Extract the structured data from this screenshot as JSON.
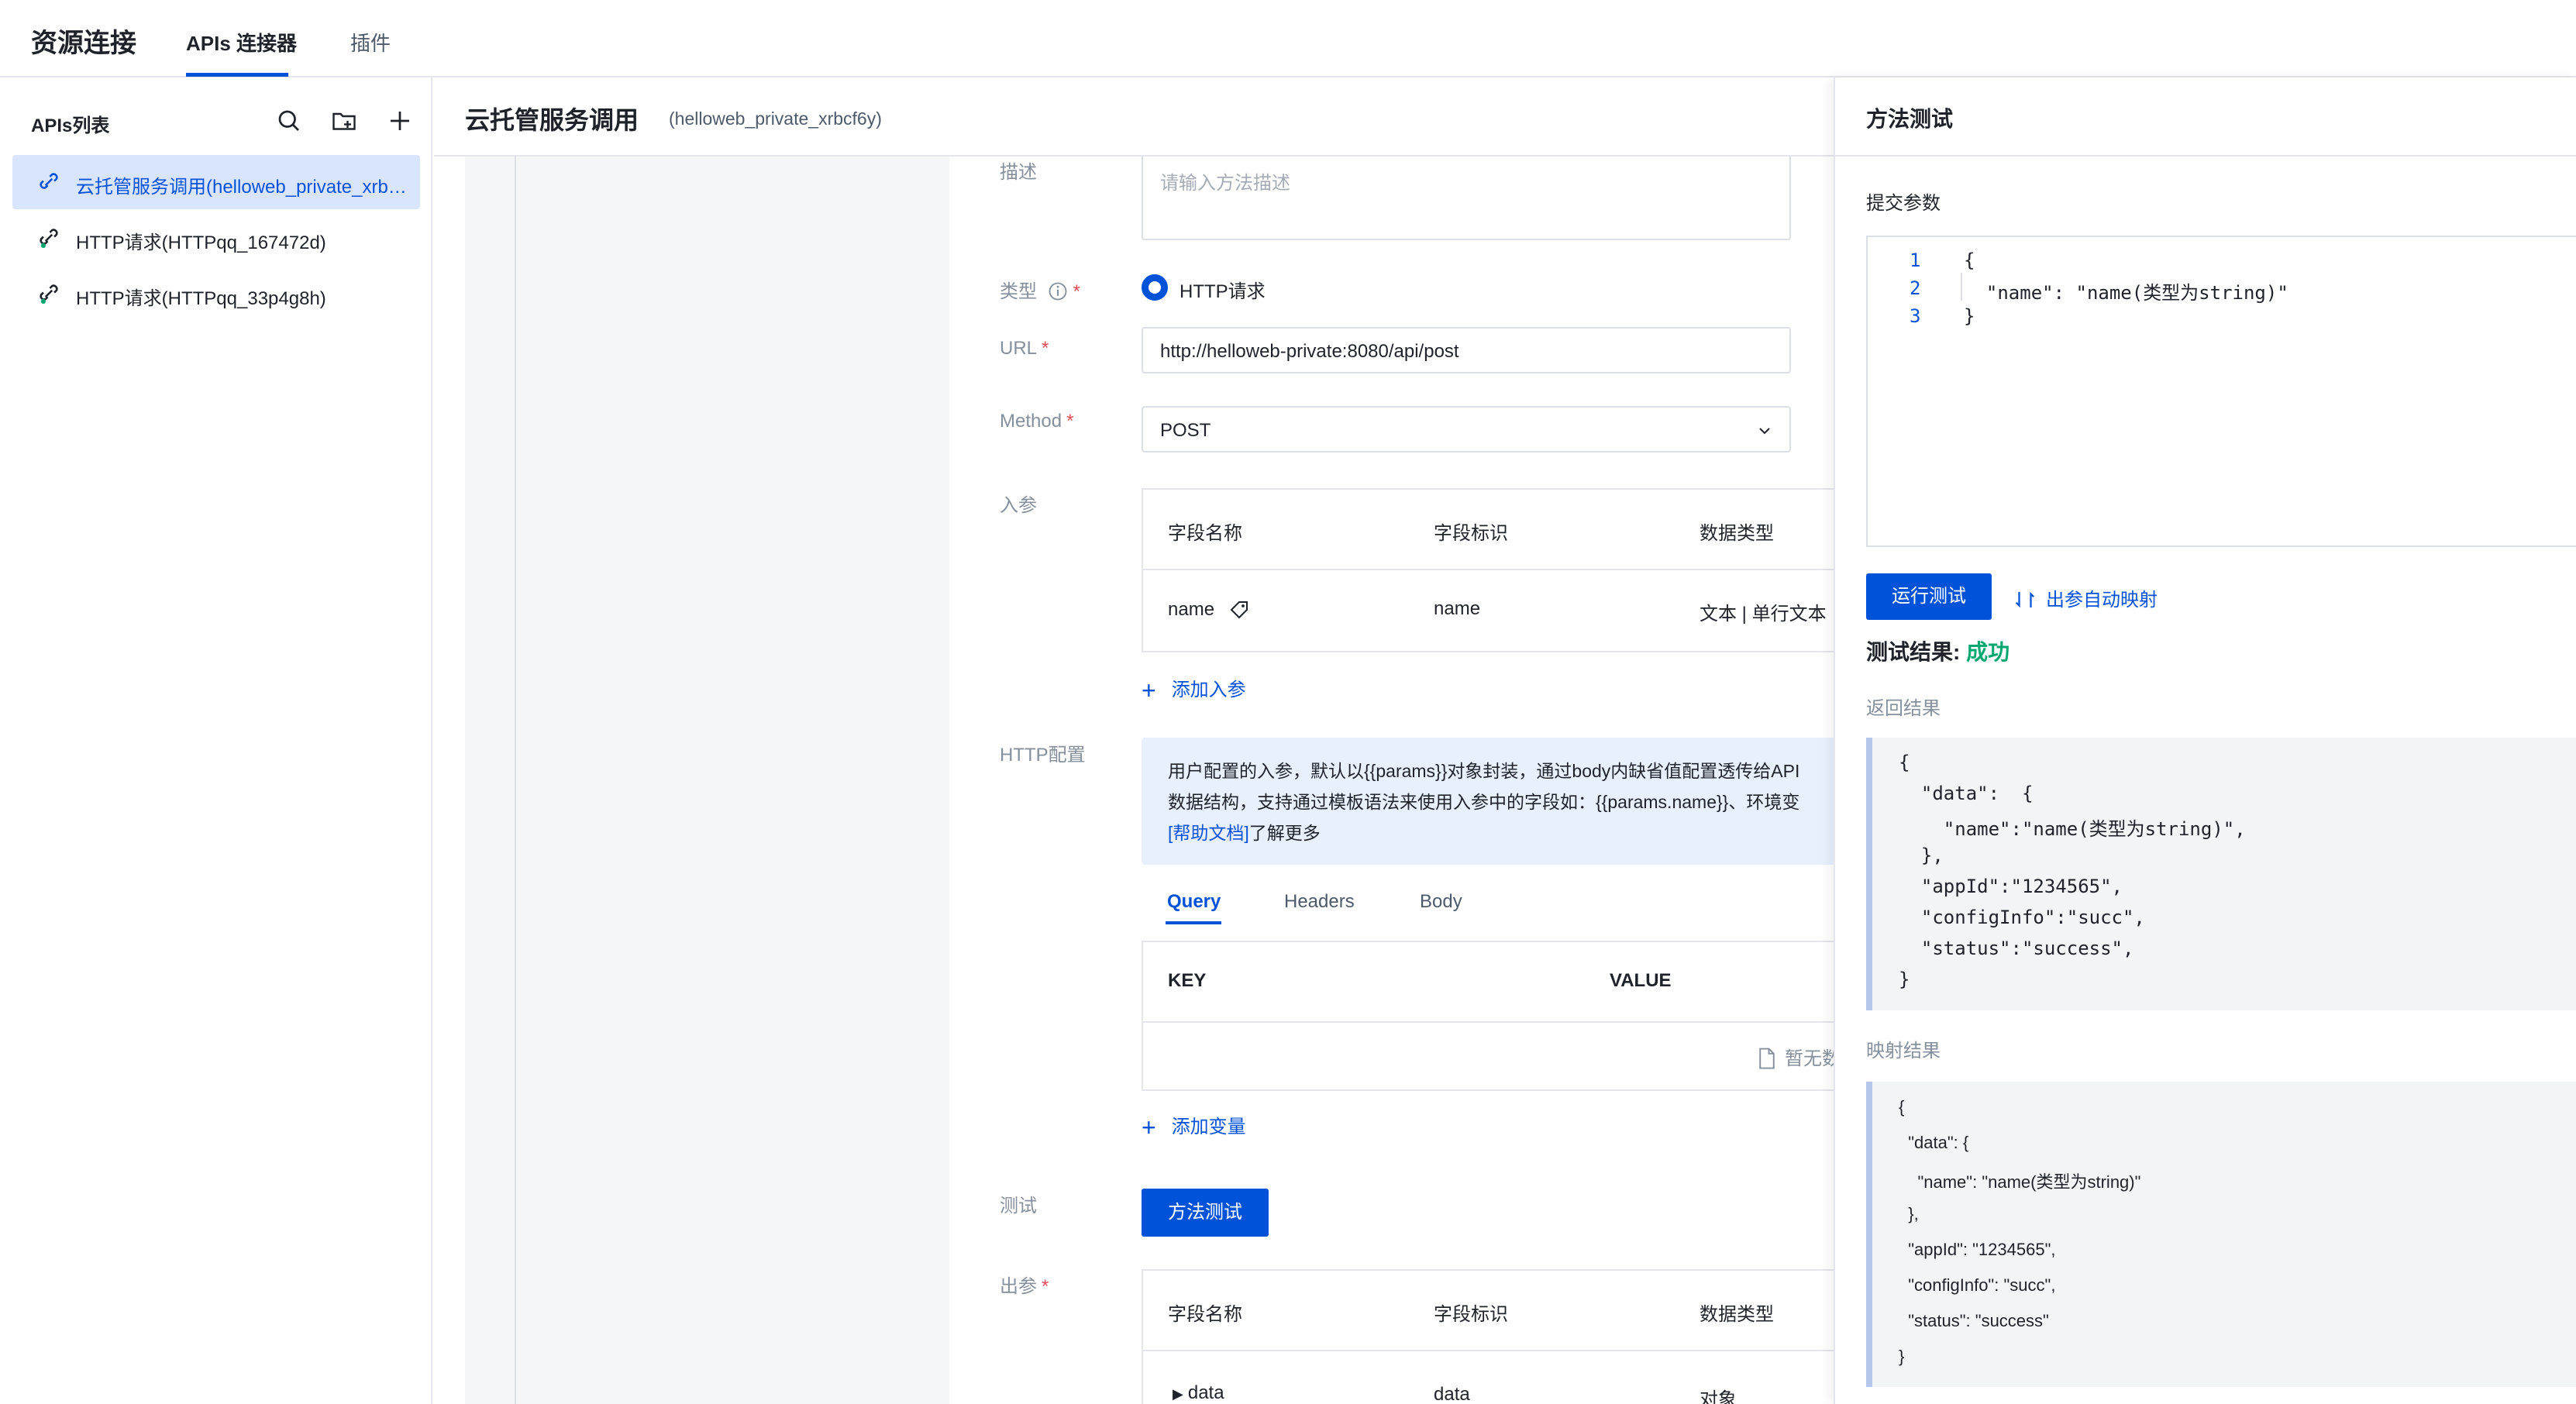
{
  "app": {
    "title": "资源连接",
    "tabs": [
      "APIs 连接器",
      "插件"
    ]
  },
  "sidebar": {
    "title": "APIs列表",
    "items": [
      {
        "label": "云托管服务调用(helloweb_private_xrbc…"
      },
      {
        "label": "HTTP请求(HTTPqq_167472d)"
      },
      {
        "label": "HTTP请求(HTTPqq_33p4g8h)"
      }
    ],
    "icons": [
      "search-icon",
      "new-folder-icon",
      "plus-icon"
    ]
  },
  "main": {
    "title": "云托管服务调用",
    "subtitle": "(helloweb_private_xrbcf6y)",
    "form": {
      "desc_label": "描述",
      "desc_placeholder": "请输入方法描述",
      "type_label": "类型",
      "type_value": "HTTP请求",
      "url_label": "URL",
      "url_value": "http://helloweb-private:8080/api/post",
      "method_label": "Method",
      "method_value": "POST",
      "input_label": "入参",
      "input_headers": [
        "字段名称",
        "字段标识",
        "数据类型"
      ],
      "input_rows": [
        {
          "name": "name",
          "id": "name",
          "type": "文本 | 单行文本"
        }
      ],
      "add_input": "添加入参",
      "http_label": "HTTP配置",
      "tip_line1": "用户配置的入参，默认以{{params}}对象封装，通过body内缺省值配置透传给API",
      "tip_line2": "数据结构，支持通过模板语法来使用入参中的字段如：{{params.name}}、环境变",
      "tip_link": "[帮助文档]",
      "tip_tail": "了解更多",
      "sub_tabs": [
        "Query",
        "Headers",
        "Body"
      ],
      "kv_headers": [
        "KEY",
        "VALUE"
      ],
      "empty_text": "暂无数",
      "add_var": "添加变量",
      "test_label": "测试",
      "test_button": "方法测试",
      "output_label": "出参",
      "output_headers": [
        "字段名称",
        "字段标识",
        "数据类型"
      ],
      "output_rows": [
        {
          "name": "data",
          "id": "data",
          "type": "对象"
        }
      ]
    }
  },
  "panel": {
    "title": "方法测试",
    "submit_label": "提交参数",
    "editor_lines": [
      "{",
      "  \"name\": \"name(类型为string)\"",
      "}"
    ],
    "run_button": "运行测试",
    "auto_map": "出参自动映射",
    "result_label": "测试结果:",
    "result_status": "成功",
    "return_label": "返回结果",
    "return_lines": [
      "{",
      "  \"data\":  {",
      "    \"name\":\"name(类型为string)\",",
      "  },",
      "  \"appId\":\"1234565\",",
      "  \"configInfo\":\"succ\",",
      "  \"status\":\"success\",",
      "}"
    ],
    "map_label": "映射结果",
    "map_lines": [
      "{",
      "  \"data\": {",
      "    \"name\": \"name(类型为string)\"",
      "  },",
      "  \"appId\": \"1234565\",",
      "  \"configInfo\": \"succ\",",
      "  \"status\": \"success\"",
      "}"
    ]
  },
  "colors": {
    "accent": "#0052d9",
    "success": "#00a870",
    "required": "#e34d59"
  }
}
